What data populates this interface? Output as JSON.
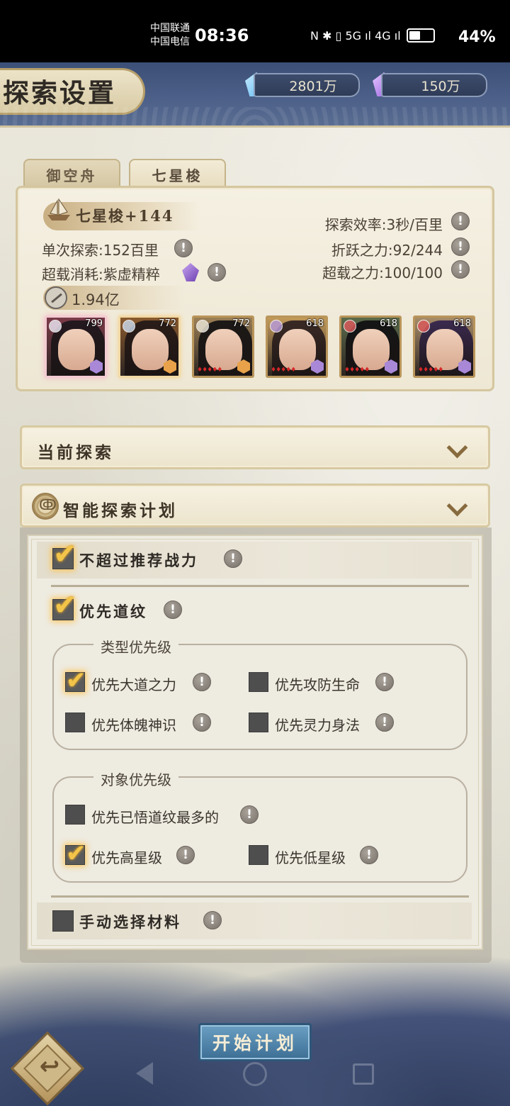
{
  "status_bar": {
    "carrier_1": "中国联通",
    "carrier_2": "中国电信",
    "time": "08:36",
    "icons_text": "N ✱ ▯ 5G ıl 4G ıl",
    "battery": "44%",
    "battery_level": 0.44
  },
  "header": {
    "title": "探索设置",
    "currency_blue": "2801万",
    "currency_purple": "150万",
    "blue_crystal_color": "#5db8f0",
    "purple_crystal_color": "#9a5ce0"
  },
  "tabs": [
    {
      "label": "御空舟",
      "active": false
    },
    {
      "label": "七星梭",
      "active": true
    }
  ],
  "ship": {
    "name": "七星梭+144",
    "single_explore": "单次探索:152百里",
    "overload_cost": "超载消耗:紫虚精粹",
    "explore_efficiency": "探索效率:3秒/百里",
    "fold_power": "折跃之力:92/244",
    "overload_power": "超载之力:100/100",
    "power": "1.94亿",
    "heroes": [
      {
        "level": "799",
        "element_color": "#e8e2ee",
        "badge_color": "#a988d8",
        "bg": "#7b3a48",
        "hair": "#24191f"
      },
      {
        "level": "772",
        "element_color": "#c8d5e5",
        "badge_color": "#e9a24a",
        "bg": "#8a5a2e",
        "hair": "#2b1d18"
      },
      {
        "level": "772",
        "element_color": "#e8e2d2",
        "badge_color": "#e9a24a",
        "bg": "#9b7f55",
        "hair": "#1c1917"
      },
      {
        "level": "618",
        "element_color": "#b89ad6",
        "badge_color": "#a988d8",
        "bg": "#c29a5a",
        "hair": "#3a2a25"
      },
      {
        "level": "618",
        "element_color": "#d85a5a",
        "badge_color": "#a988d8",
        "bg": "#5a6a4a",
        "hair": "#151515"
      },
      {
        "level": "618",
        "element_color": "#d85a5a",
        "badge_color": "#a988d8",
        "bg": "#a88c68",
        "hair": "#3b2a4e"
      }
    ]
  },
  "sections": {
    "current_explore": "当前探索",
    "smart_plan": "智能探索计划"
  },
  "options": {
    "not_exceed_power": {
      "label": "不超过推荐战力",
      "checked": true
    },
    "prioritize_pattern": {
      "label": "优先道纹",
      "checked": true
    },
    "type_priority_title": "类型优先级",
    "type_priority": [
      {
        "label": "优先大道之力",
        "checked": true
      },
      {
        "label": "优先攻防生命",
        "checked": false
      },
      {
        "label": "优先体魄神识",
        "checked": false
      },
      {
        "label": "优先灵力身法",
        "checked": false
      }
    ],
    "target_priority_title": "对象优先级",
    "target_priority": [
      {
        "label": "优先已悟道纹最多的",
        "checked": false
      },
      {
        "label": "优先高星级",
        "checked": true
      },
      {
        "label": "优先低星级",
        "checked": false
      }
    ],
    "manual_select": {
      "label": "手动选择材料",
      "checked": false
    },
    "checkmark": "✔",
    "info": "!"
  },
  "footer": {
    "start_button": "开始计划",
    "back_icon_glyph": "↩"
  },
  "nav": {
    "back": "back-triangle",
    "home": "home-circle",
    "recent": "recent-square"
  }
}
